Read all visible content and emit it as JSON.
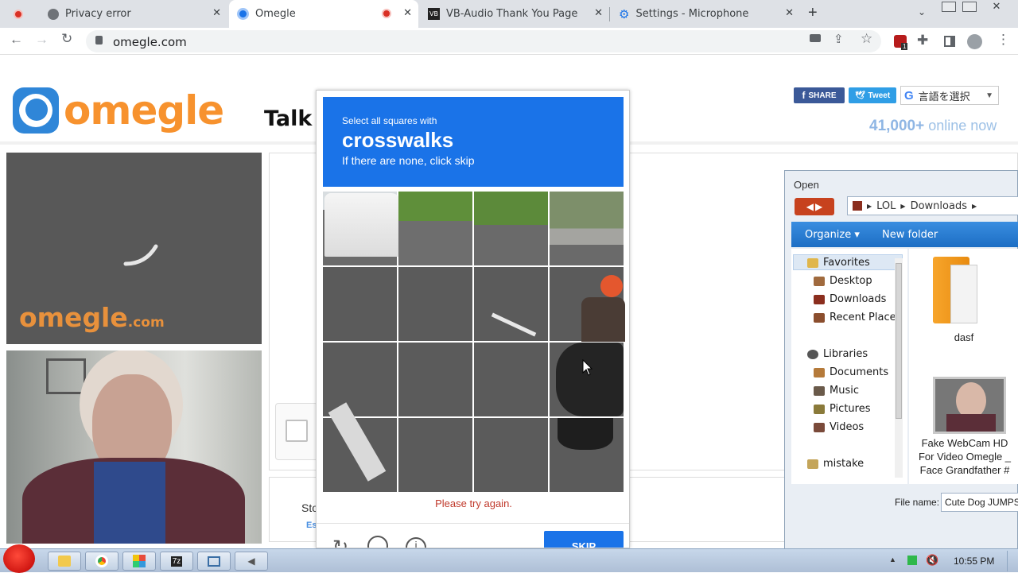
{
  "browser": {
    "tabs": [
      {
        "title": "Privacy error"
      },
      {
        "title": "Omegle"
      },
      {
        "title": "VB-Audio Thank You Page"
      },
      {
        "title": "Settings - Microphone"
      }
    ],
    "url": "omegle.com",
    "extension_badge": "1"
  },
  "omegle": {
    "logo": "omegle",
    "tagline": "Talk t",
    "share_label": "SHARE",
    "tweet_label": "Tweet",
    "language_select": "言語を選択",
    "online_count": "41,000+",
    "online_label": "online now",
    "video_watermark": "omegle",
    "video_watermark_suffix": ".com",
    "bottom_text": "Sto",
    "bottom_link": "Esc"
  },
  "captcha": {
    "instruction_small": "Select all squares with",
    "target": "crosswalks",
    "hint": "If there are none, click skip",
    "error": "Please try again.",
    "skip_label": "SKIP",
    "colors": {
      "header": "#1a73e8",
      "error": "#c0392b"
    }
  },
  "open_dialog": {
    "title": "Open",
    "breadcrumb": [
      "LOL",
      "Downloads"
    ],
    "organize_label": "Organize",
    "new_folder_label": "New folder",
    "favorites_label": "Favorites",
    "favorites": [
      "Desktop",
      "Downloads",
      "Recent Places"
    ],
    "libraries_label": "Libraries",
    "libraries": [
      "Documents",
      "Music",
      "Pictures",
      "Videos"
    ],
    "other": "mistake",
    "files": [
      {
        "name": "dasf",
        "icon": "folder-icon"
      },
      {
        "name": "Fake WebCam HD For Video Omegle _ Face Grandfather #",
        "icon": "video-thumbnail-icon"
      }
    ],
    "filename_label": "File name:",
    "filename_value": "Cute Dog JUMPSC"
  },
  "taskbar": {
    "clock": "10:55 PM"
  }
}
